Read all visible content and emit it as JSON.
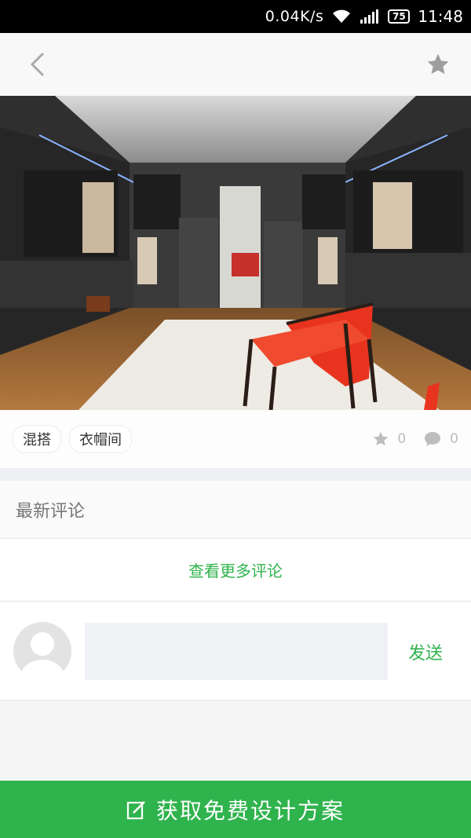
{
  "status_bar": {
    "network_speed": "0.04K/s",
    "battery": "75",
    "time": "11:48"
  },
  "top_bar": {
    "back_icon": "chevron-left-icon",
    "favorite_icon": "star-icon"
  },
  "tags": [
    "混搭",
    "衣帽间"
  ],
  "stats": {
    "likes": "0",
    "comments": "0"
  },
  "comments_section": {
    "title": "最新评论",
    "view_more": "查看更多评论"
  },
  "compose": {
    "input_value": "",
    "send_label": "发送"
  },
  "cta": {
    "label": "获取免费设计方案",
    "icon": "edit-icon"
  },
  "colors": {
    "accent": "#2fb34d",
    "status_bar": "#000000",
    "chair": "#e8341f"
  }
}
